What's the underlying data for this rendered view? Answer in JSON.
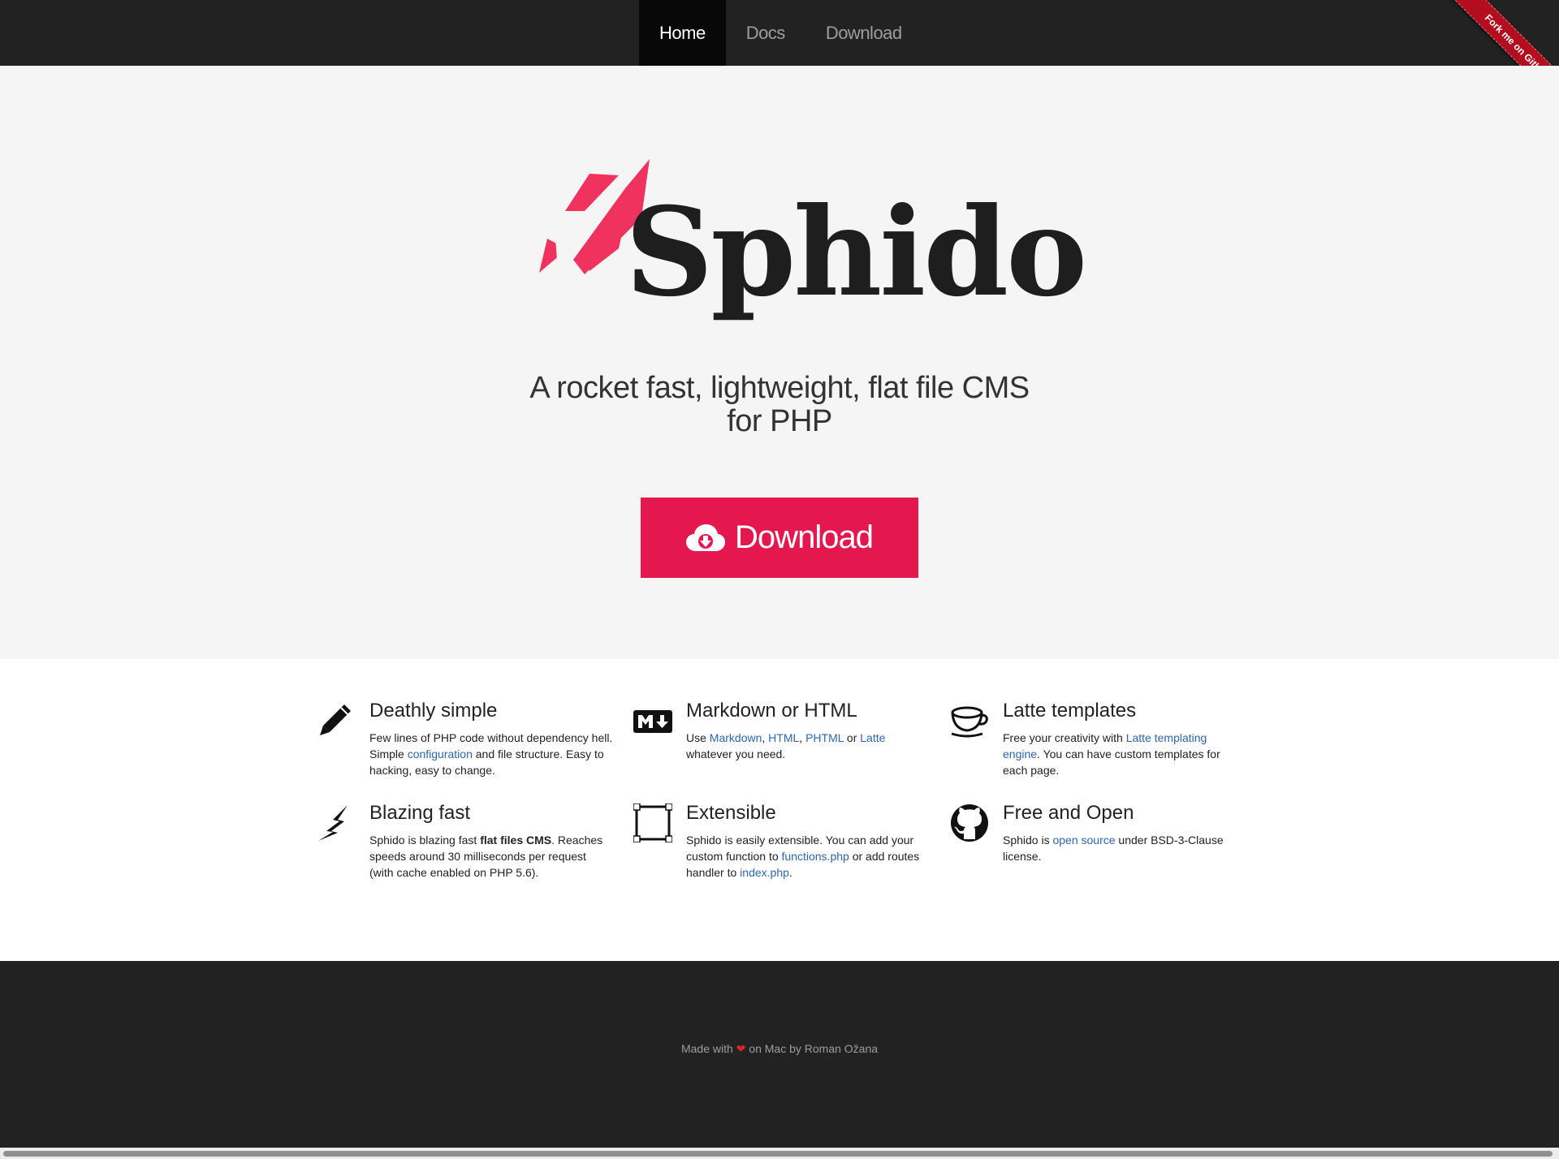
{
  "nav": {
    "items": [
      {
        "label": "Home",
        "active": true
      },
      {
        "label": "Docs",
        "active": false
      },
      {
        "label": "Download",
        "active": false
      }
    ],
    "ribbon": "Fork me on GitHub"
  },
  "hero": {
    "logo_text": "Sphido",
    "tagline_line1": "A rocket fast, lightweight, flat file CMS",
    "tagline_line2": "for PHP",
    "download_label": "Download",
    "brand_color": "#e4184f",
    "rocket_color": "#f0325f"
  },
  "features": [
    {
      "icon": "pencil-icon",
      "title": "Deathly simple",
      "desc": {
        "p1": "Few lines of PHP code without dependency hell. Simple ",
        "link1": "configuration",
        "p2": " and file structure. Easy to hacking, easy to change."
      }
    },
    {
      "icon": "markdown-icon",
      "title": "Markdown or HTML",
      "desc": {
        "p1": "Use ",
        "link1": "Markdown",
        "p2": ", ",
        "link2": "HTML",
        "p3": ", ",
        "link3": "PHTML",
        "p4": " or ",
        "link4": "Latte",
        "p5": " whatever you need."
      }
    },
    {
      "icon": "coffee-cup-icon",
      "title": "Latte templates",
      "desc": {
        "p1": "Free your creativity with ",
        "link1": "Latte templating engine",
        "p2": ". You can have custom templates for each page."
      }
    },
    {
      "icon": "lightning-icon",
      "title": "Blazing fast",
      "desc": {
        "p1": "Sphido is blazing fast ",
        "bold1": "flat files CMS",
        "p2": ". Reaches speeds around 30 milliseconds per request (with cache enabled on PHP 5.6)."
      }
    },
    {
      "icon": "expand-square-icon",
      "title": "Extensible",
      "desc": {
        "p1": "Sphido is easily extensible. You can add your custom function to ",
        "link1": "functions.php",
        "p2": " or add routes handler to ",
        "link2": "index.php",
        "p3": "."
      }
    },
    {
      "icon": "github-icon",
      "title": "Free and Open",
      "desc": {
        "p1": "Sphido is ",
        "link1": "open source",
        "p2": " under BSD-3-Clause license."
      }
    }
  ],
  "footer": {
    "made_with": "Made with",
    "heart": "❤",
    "rest": "on Mac by Roman Ožana"
  },
  "colors": {
    "nav_bg": "#222222",
    "hero_bg": "#f5f5f5",
    "link": "#2c66b0",
    "ribbon": "#b30e1e"
  }
}
